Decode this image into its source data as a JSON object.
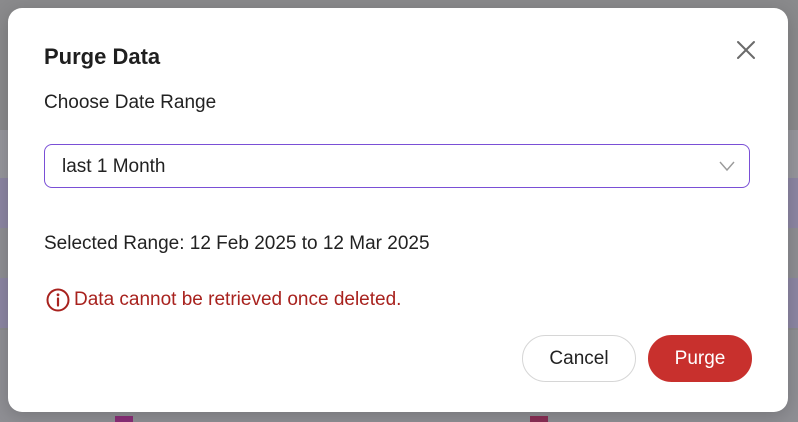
{
  "dialog": {
    "title": "Purge Data",
    "subtitle": "Choose Date Range",
    "date_range_select": {
      "value": "last 1 Month"
    },
    "selected_range_text": "Selected Range: 12 Feb 2025 to 12 Mar 2025",
    "warning_text": "Data cannot be retrieved once deleted.",
    "buttons": {
      "cancel": "Cancel",
      "purge": "Purge"
    }
  },
  "colors": {
    "accent_border": "#7a4fd6",
    "danger": "#c8302d",
    "warning_text": "#a8221e"
  },
  "icons": {
    "close": "close-icon",
    "chevron": "chevron-down-icon",
    "warning": "info-circle-icon"
  }
}
